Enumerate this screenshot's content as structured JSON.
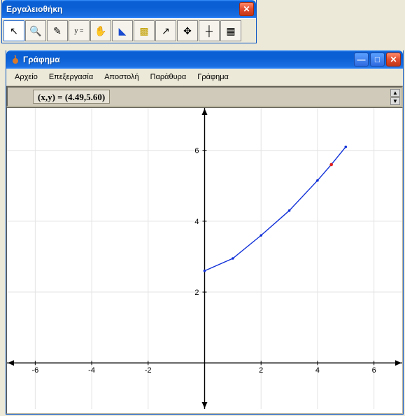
{
  "toolbox": {
    "title": "Εργαλειοθήκη",
    "tools": [
      {
        "name": "pointer",
        "glyph": "↖"
      },
      {
        "name": "zoom",
        "glyph": "🔍"
      },
      {
        "name": "pencil",
        "glyph": "✎"
      },
      {
        "name": "y-equals",
        "glyph": "y ="
      },
      {
        "name": "grab",
        "glyph": "✋"
      },
      {
        "name": "triangle",
        "glyph": "◣"
      },
      {
        "name": "bar",
        "glyph": "▩"
      },
      {
        "name": "segment",
        "glyph": "↗"
      },
      {
        "name": "move",
        "glyph": "✥"
      },
      {
        "name": "axes",
        "glyph": "┼"
      },
      {
        "name": "grid",
        "glyph": "▦"
      }
    ]
  },
  "graphwin": {
    "title": "Γράφημα",
    "menus": [
      "Αρχείο",
      "Επεξεργασία",
      "Αποστολή",
      "Παράθυρα",
      "Γράφημα"
    ],
    "readout": "(x,y) = (4.49,5.60)"
  },
  "titlebar_buttons": {
    "minimize": "—",
    "maximize": "□",
    "close": "✕"
  },
  "chart_data": {
    "type": "line",
    "title": "",
    "xlabel": "",
    "ylabel": "",
    "xlim": [
      -7,
      7
    ],
    "ylim": [
      -1.3,
      7.2
    ],
    "xticks": [
      -6,
      -4,
      -2,
      2,
      4,
      6
    ],
    "yticks": [
      2,
      4,
      6
    ],
    "grid": true,
    "series": [
      {
        "name": "curve",
        "color": "#1030d8",
        "x": [
          0,
          1,
          2,
          3,
          4,
          4.49,
          5
        ],
        "y": [
          2.6,
          2.95,
          3.6,
          4.3,
          5.15,
          5.6,
          6.1
        ]
      }
    ],
    "highlight_point": {
      "x": 4.49,
      "y": 5.6,
      "color": "#e02020"
    }
  }
}
